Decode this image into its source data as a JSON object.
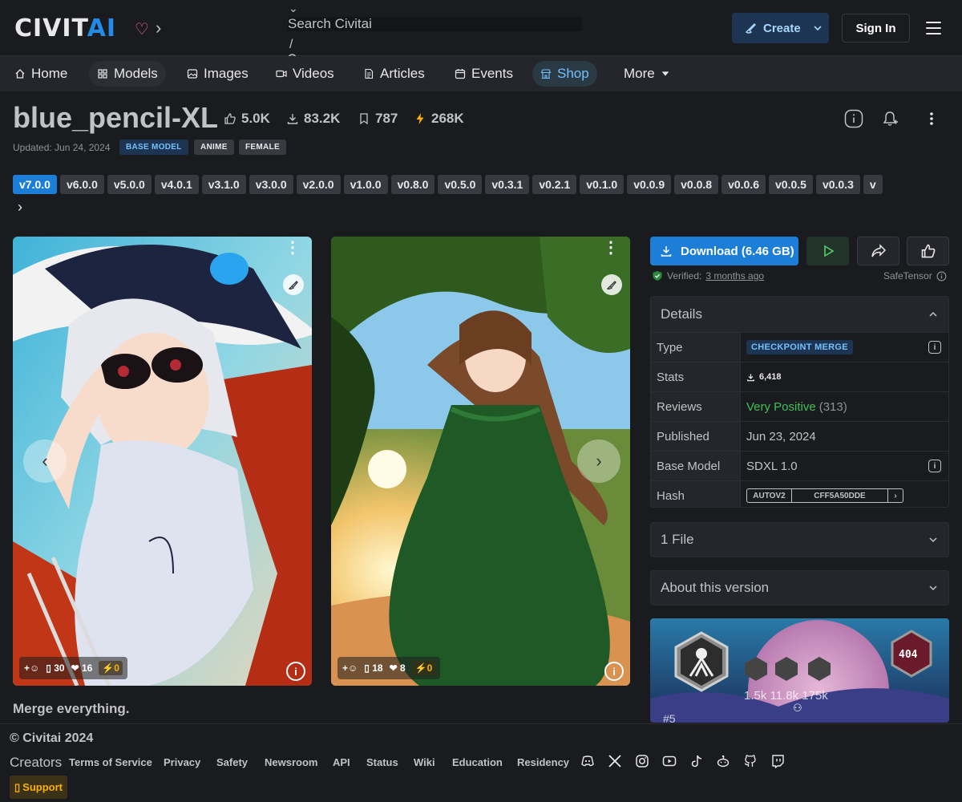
{
  "header": {
    "logo_main": "CIVIT",
    "logo_accent": "AI",
    "search_placeholder": "Search Civitai",
    "search_shortcut": "/",
    "create_label": "Create",
    "signin_label": "Sign In"
  },
  "nav": {
    "items": [
      {
        "label": "Home",
        "icon": "home-icon"
      },
      {
        "label": "Models",
        "icon": "grid-icon"
      },
      {
        "label": "Images",
        "icon": "photo-icon"
      },
      {
        "label": "Videos",
        "icon": "video-icon"
      },
      {
        "label": "Articles",
        "icon": "article-icon"
      },
      {
        "label": "Events",
        "icon": "calendar-icon"
      },
      {
        "label": "Shop",
        "icon": "shop-icon"
      },
      {
        "label": "More",
        "icon": "caret-down-icon"
      }
    ]
  },
  "model": {
    "title": "blue_pencil-XL",
    "likes": "5.0K",
    "downloads": "83.2K",
    "bookmarks": "787",
    "buzz": "268K",
    "updated": "Updated: Jun 24, 2024",
    "badges": [
      "BASE MODEL",
      "ANIME",
      "FEMALE"
    ],
    "description": "Merge everything."
  },
  "versions": [
    "v7.0.0",
    "v6.0.0",
    "v5.0.0",
    "v4.0.1",
    "v3.1.0",
    "v3.0.0",
    "v2.0.0",
    "v1.0.0",
    "v0.8.0",
    "v0.5.0",
    "v0.3.1",
    "v0.2.1",
    "v0.1.0",
    "v0.0.9",
    "v0.0.8",
    "v0.0.6",
    "v0.0.5",
    "v0.0.3",
    "v"
  ],
  "gallery": [
    {
      "comments": "30",
      "hearts": "16",
      "buzz": "0"
    },
    {
      "comments": "18",
      "hearts": "8",
      "buzz": "0"
    }
  ],
  "sidebar": {
    "download_label": "Download (6.46 GB)",
    "verified_label": "Verified:",
    "verified_time": "3 months ago",
    "safetensor": "SafeTensor",
    "details_title": "Details",
    "details": {
      "type_key": "Type",
      "type_value": "CHECKPOINT MERGE",
      "stats_key": "Stats",
      "stats_value": "6,418",
      "reviews_key": "Reviews",
      "reviews_value": "Very Positive",
      "reviews_count": "(313)",
      "published_key": "Published",
      "published_value": "Jun 23, 2024",
      "base_key": "Base Model",
      "base_value": "SDXL 1.0",
      "hash_key": "Hash",
      "hash_type": "AUTOV2",
      "hash_value": "CFF5A50DDE"
    },
    "files_label": "1 File",
    "about_label": "About this version",
    "banner": {
      "badge_text": "404",
      "stats": "1.5k 11.8k 175k",
      "rank": "#5"
    }
  },
  "footer": {
    "copyright": "© Civitai 2024",
    "creators": "Creators",
    "links": [
      "Terms of Service",
      "Privacy",
      "Safety",
      "Newsroom",
      "API",
      "Status",
      "Wiki",
      "Education",
      "Residency"
    ],
    "social": [
      "discord-icon",
      "x-icon",
      "instagram-icon",
      "youtube-icon",
      "tiktok-icon",
      "reddit-icon",
      "github-icon",
      "twitch-icon"
    ],
    "support": "Support"
  },
  "colors": {
    "accent": "#1c7ed6",
    "background": "#1a1b1e",
    "positive": "#40c057",
    "buzz": "#fab005"
  }
}
